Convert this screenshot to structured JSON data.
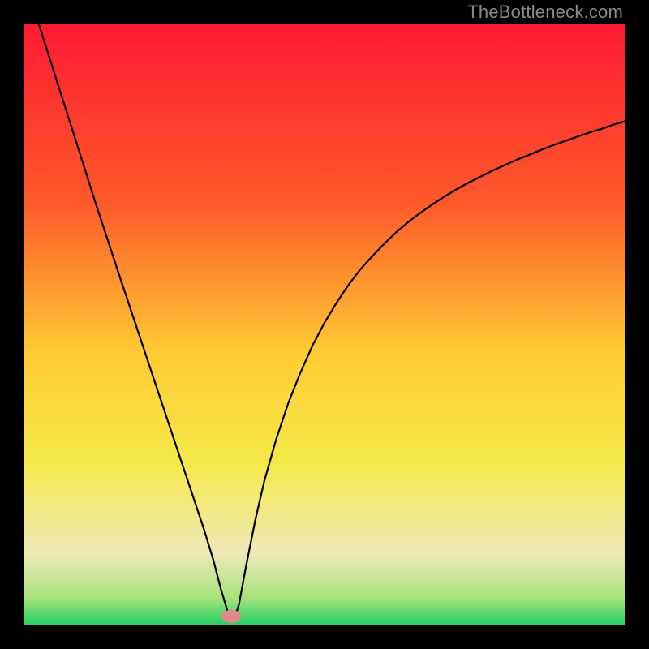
{
  "watermark": "TheBottleneck.com",
  "chart_data": {
    "type": "line",
    "title": "",
    "xlabel": "",
    "ylabel": "",
    "xlim": [
      0,
      1
    ],
    "ylim": [
      0,
      1
    ],
    "gradient_stops": [
      {
        "pos": 0,
        "color": "#ff1a33"
      },
      {
        "pos": 0.3,
        "color": "#ff5a2b"
      },
      {
        "pos": 0.55,
        "color": "#ffcc33"
      },
      {
        "pos": 0.73,
        "color": "#f5e94a"
      },
      {
        "pos": 0.88,
        "color": "#efe8b8"
      },
      {
        "pos": 0.955,
        "color": "#a5e27a"
      },
      {
        "pos": 1.0,
        "color": "#1fd063"
      }
    ],
    "notch": {
      "x": 0.345,
      "y": 0.021
    },
    "marker": {
      "x": 0.345,
      "y": 0.015,
      "rx": 0.016,
      "ry": 0.011,
      "color": "#e28a8a"
    },
    "series": [
      {
        "name": "curve",
        "stroke": "#000000",
        "stroke_width": 2.2,
        "points": [
          [
            0.0,
            1.08
          ],
          [
            0.02,
            1.016
          ],
          [
            0.04,
            0.953
          ],
          [
            0.06,
            0.89
          ],
          [
            0.08,
            0.827
          ],
          [
            0.1,
            0.764
          ],
          [
            0.12,
            0.701
          ],
          [
            0.14,
            0.64
          ],
          [
            0.16,
            0.579
          ],
          [
            0.18,
            0.519
          ],
          [
            0.2,
            0.459
          ],
          [
            0.22,
            0.399
          ],
          [
            0.24,
            0.339
          ],
          [
            0.26,
            0.279
          ],
          [
            0.28,
            0.219
          ],
          [
            0.3,
            0.159
          ],
          [
            0.315,
            0.11
          ],
          [
            0.328,
            0.06
          ],
          [
            0.34,
            0.02
          ],
          [
            0.345,
            0.008
          ],
          [
            0.35,
            0.01
          ],
          [
            0.358,
            0.035
          ],
          [
            0.37,
            0.1
          ],
          [
            0.385,
            0.175
          ],
          [
            0.4,
            0.24
          ],
          [
            0.42,
            0.31
          ],
          [
            0.44,
            0.37
          ],
          [
            0.46,
            0.42
          ],
          [
            0.48,
            0.465
          ],
          [
            0.5,
            0.503
          ],
          [
            0.52,
            0.536
          ],
          [
            0.54,
            0.566
          ],
          [
            0.56,
            0.592
          ],
          [
            0.58,
            0.614
          ],
          [
            0.6,
            0.635
          ],
          [
            0.62,
            0.654
          ],
          [
            0.64,
            0.671
          ],
          [
            0.66,
            0.686
          ],
          [
            0.68,
            0.7
          ],
          [
            0.7,
            0.713
          ],
          [
            0.72,
            0.725
          ],
          [
            0.74,
            0.736
          ],
          [
            0.76,
            0.746
          ],
          [
            0.78,
            0.756
          ],
          [
            0.8,
            0.765
          ],
          [
            0.82,
            0.774
          ],
          [
            0.84,
            0.782
          ],
          [
            0.86,
            0.79
          ],
          [
            0.88,
            0.798
          ],
          [
            0.9,
            0.805
          ],
          [
            0.92,
            0.812
          ],
          [
            0.94,
            0.819
          ],
          [
            0.96,
            0.825
          ],
          [
            0.98,
            0.832
          ],
          [
            1.0,
            0.838
          ]
        ]
      }
    ]
  }
}
